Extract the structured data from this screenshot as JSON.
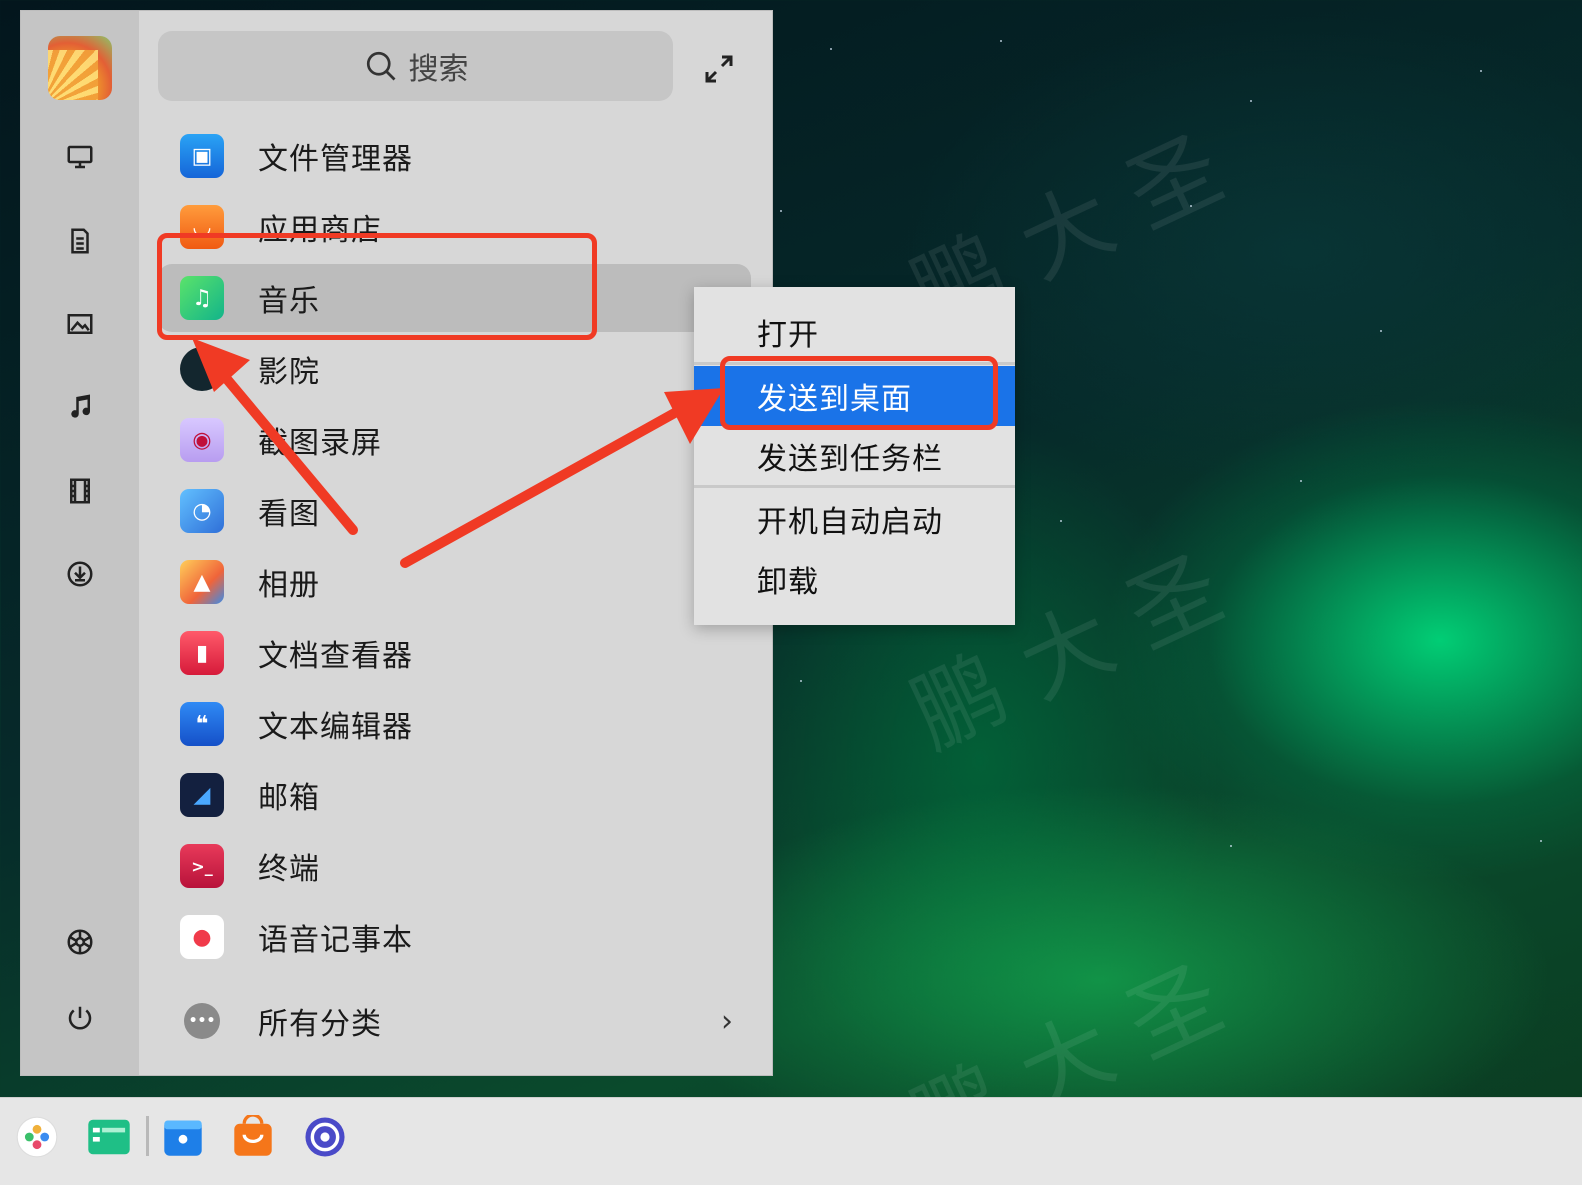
{
  "search": {
    "placeholder": "搜索"
  },
  "rail": {
    "items": [
      "computer-icon",
      "document-icon",
      "picture-icon",
      "music-icon",
      "video-icon",
      "download-icon",
      "settings-icon",
      "power-icon"
    ]
  },
  "apps": [
    {
      "label": "文件管理器",
      "icon": "file-manager-icon",
      "color": "#1e88e5"
    },
    {
      "label": "应用商店",
      "icon": "app-store-icon",
      "color": "#f5761a"
    },
    {
      "label": "音乐",
      "icon": "music-app-icon",
      "color": "#2ecc71"
    },
    {
      "label": "影院",
      "icon": "cinema-icon",
      "color": "#14303a"
    },
    {
      "label": "截图录屏",
      "icon": "screenshot-icon",
      "color": "#c9b8f0"
    },
    {
      "label": "看图",
      "icon": "image-viewer-icon",
      "color": "#3b8de8"
    },
    {
      "label": "相册",
      "icon": "album-icon",
      "color": "#f28a3a"
    },
    {
      "label": "文档查看器",
      "icon": "document-viewer-icon",
      "color": "#e8304a"
    },
    {
      "label": "文本编辑器",
      "icon": "text-editor-icon",
      "color": "#1f6fe0"
    },
    {
      "label": "邮箱",
      "icon": "mail-icon",
      "color": "#15234a"
    },
    {
      "label": "终端",
      "icon": "terminal-icon",
      "color": "#d4224a"
    },
    {
      "label": "语音记事本",
      "icon": "voice-note-icon",
      "color": "#f04a5a"
    },
    {
      "label": "所有分类",
      "icon": "more-icon",
      "color": "#8a8a8a"
    }
  ],
  "context_menu": {
    "items": [
      "打开",
      "发送到桌面",
      "发送到任务栏",
      "开机自动启动",
      "卸载"
    ],
    "selected": "发送到桌面"
  },
  "taskbar": {
    "items": [
      "launcher-icon",
      "multitask-icon",
      "file-manager-icon",
      "app-store-icon",
      "settings-icon"
    ]
  },
  "watermark": "鹏 大 圣"
}
